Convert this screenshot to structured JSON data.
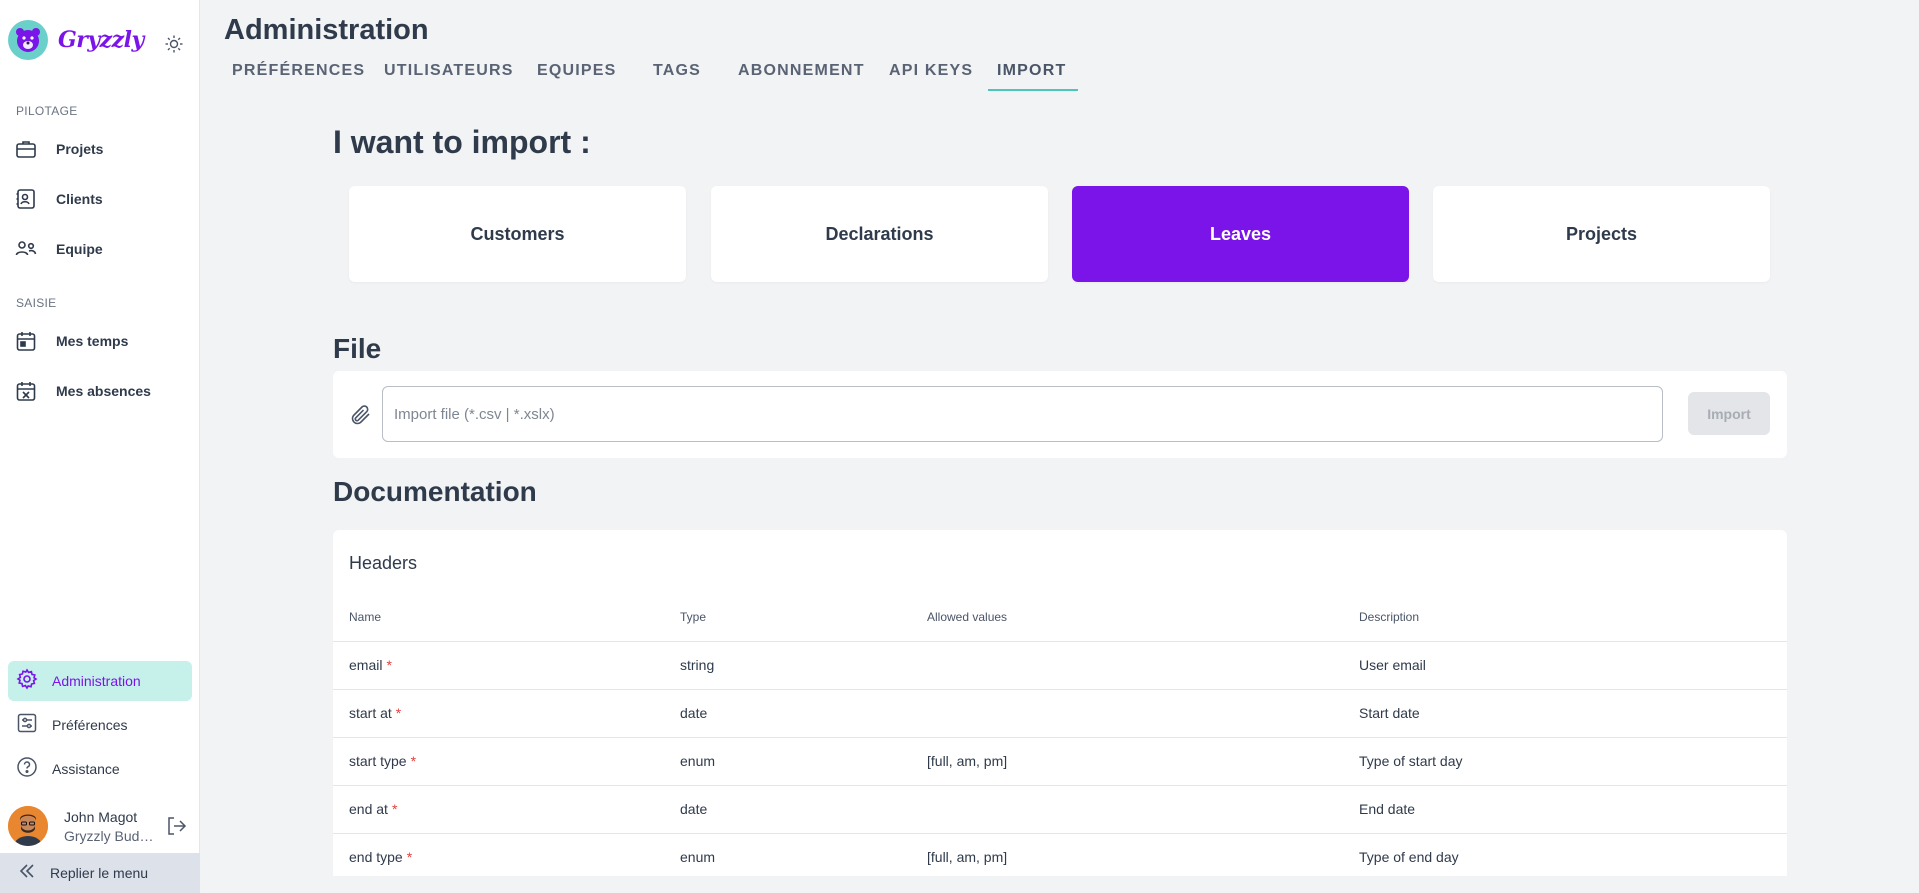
{
  "app": {
    "brand": "Gryzzly"
  },
  "sidebar": {
    "sections": [
      {
        "label": "PILOTAGE",
        "items": [
          {
            "label": "Projets",
            "icon": "briefcase-icon"
          },
          {
            "label": "Clients",
            "icon": "contact-card-icon"
          },
          {
            "label": "Equipe",
            "icon": "users-icon"
          }
        ]
      },
      {
        "label": "SAISIE",
        "items": [
          {
            "label": "Mes temps",
            "icon": "calendar-icon"
          },
          {
            "label": "Mes absences",
            "icon": "calendar-x-icon"
          }
        ]
      }
    ],
    "bottom": [
      {
        "label": "Administration",
        "icon": "gear-icon",
        "active": true
      },
      {
        "label": "Préférences",
        "icon": "sliders-icon",
        "active": false
      },
      {
        "label": "Assistance",
        "icon": "help-icon",
        "active": false
      }
    ],
    "user": {
      "name": "John Magot",
      "org": "Gryzzly Budget"
    },
    "collapse_label": "Replier le menu"
  },
  "header": {
    "title": "Administration",
    "tabs": [
      "PRÉFÉRENCES",
      "UTILISATEURS",
      "EQUIPES",
      "TAGS",
      "ABONNEMENT",
      "API KEYS",
      "IMPORT"
    ],
    "active_tab": "IMPORT"
  },
  "import": {
    "heading": "I want to import :",
    "types": [
      "Customers",
      "Declarations",
      "Leaves",
      "Projects"
    ],
    "selected": "Leaves"
  },
  "file": {
    "heading": "File",
    "placeholder": "Import file (*.csv | *.xslx)",
    "value": "",
    "button": "Import"
  },
  "documentation": {
    "heading": "Documentation",
    "subheading": "Headers",
    "columns": [
      "Name",
      "Type",
      "Allowed values",
      "Description"
    ],
    "rows": [
      {
        "name": "email",
        "required": "*",
        "type": "string",
        "allowed": "",
        "description": "User email"
      },
      {
        "name": "start at",
        "required": "*",
        "type": "date",
        "allowed": "",
        "description": "Start date"
      },
      {
        "name": "start type",
        "required": "*",
        "type": "enum",
        "allowed": "[full, am, pm]",
        "description": "Type of start day"
      },
      {
        "name": "end at",
        "required": "*",
        "type": "date",
        "allowed": "",
        "description": "End date"
      },
      {
        "name": "end type",
        "required": "*",
        "type": "enum",
        "allowed": "[full, am, pm]",
        "description": "Type of end day"
      }
    ]
  },
  "colors": {
    "accent": "#7a14e8",
    "active_bg": "#c6f0ea",
    "tab_underline": "#4ec5b9",
    "required": "#e53e3e"
  }
}
